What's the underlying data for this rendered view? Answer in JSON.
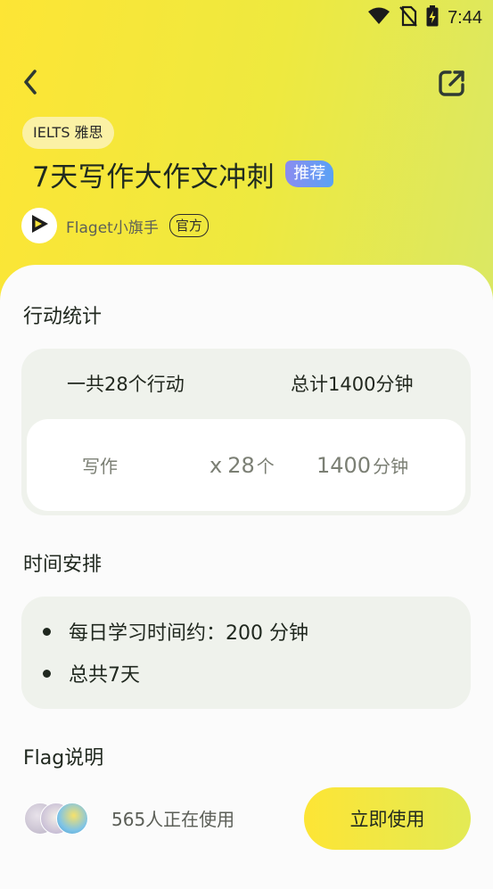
{
  "status_bar": {
    "time": "7:44",
    "icons": [
      "wifi-icon",
      "no-sim-icon",
      "battery-charging-icon"
    ]
  },
  "header": {
    "back_icon": "chevron-left-icon",
    "share_icon": "share-external-icon",
    "category_tag": "IELTS 雅思",
    "title": "7天写作大作文冲刺",
    "badge": "推荐",
    "author": {
      "name": "Flaget小旗手",
      "official_badge": "官方",
      "avatar_icon": "flaget-logo-icon"
    }
  },
  "stats": {
    "heading": "行动统计",
    "total_actions": "一共28个行动",
    "total_minutes": "总计1400分钟",
    "item": {
      "name": "写作",
      "count_prefix": "x",
      "count_number": "28",
      "count_unit": "个",
      "minutes_number": "1400",
      "minutes_unit": "分钟"
    }
  },
  "schedule": {
    "heading": "时间安排",
    "items": [
      "每日学习时间约：200 分钟",
      "总共7天"
    ]
  },
  "flag_desc": {
    "heading": "Flag说明"
  },
  "bottom_bar": {
    "users_count_text": "565人正在使用",
    "use_button": "立即使用"
  },
  "colors": {
    "gradient_start": "#fde535",
    "gradient_end": "#d3e872",
    "badge_start": "#8b8cf0",
    "badge_end": "#59a2f5",
    "panel_bg": "#eff2ec",
    "text_dark": "#20281f",
    "text_muted": "#7b7f74"
  }
}
